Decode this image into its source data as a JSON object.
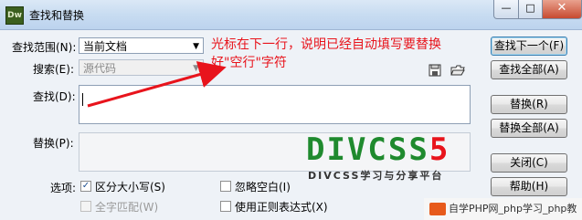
{
  "window": {
    "app_icon_text": "Dw",
    "title": "查找和替换",
    "minimize": "—",
    "maximize": "□",
    "close": "✕"
  },
  "form": {
    "scope_label": "查找范围(N):",
    "scope_value": "当前文档",
    "search_label": "搜索(E):",
    "search_value": "源代码",
    "find_label": "查找(D):",
    "find_value": "",
    "replace_label": "替换(P):",
    "replace_value": "",
    "options_label": "选项:"
  },
  "options": {
    "match_case": {
      "label": "区分大小写(S)",
      "checked": true
    },
    "ignore_whitespace": {
      "label": "忽略空白(I)",
      "checked": false
    },
    "whole_word": {
      "label": "全字匹配(W)",
      "checked": false,
      "disabled": true
    },
    "regex": {
      "label": "使用正则表达式(X)",
      "checked": false
    }
  },
  "buttons": {
    "find_next": "查找下一个(F)",
    "find_all": "查找全部(A)",
    "replace": "替换(R)",
    "replace_all": "替换全部(A)",
    "close": "关闭(C)",
    "help": "帮助(H)"
  },
  "icons": {
    "save": "save-icon",
    "open": "open-folder-icon"
  },
  "annotation": {
    "line1": "光标在下一行，说明已经自动填写要替换",
    "line2": "好\"空行\"字符",
    "color": "#e8141c"
  },
  "watermark": {
    "logo_text": "DIVCSS",
    "logo_digit": "5",
    "subtitle": "DIVCSS学习与分享平台",
    "site_text": "自学PHP网_php学习_php教"
  }
}
